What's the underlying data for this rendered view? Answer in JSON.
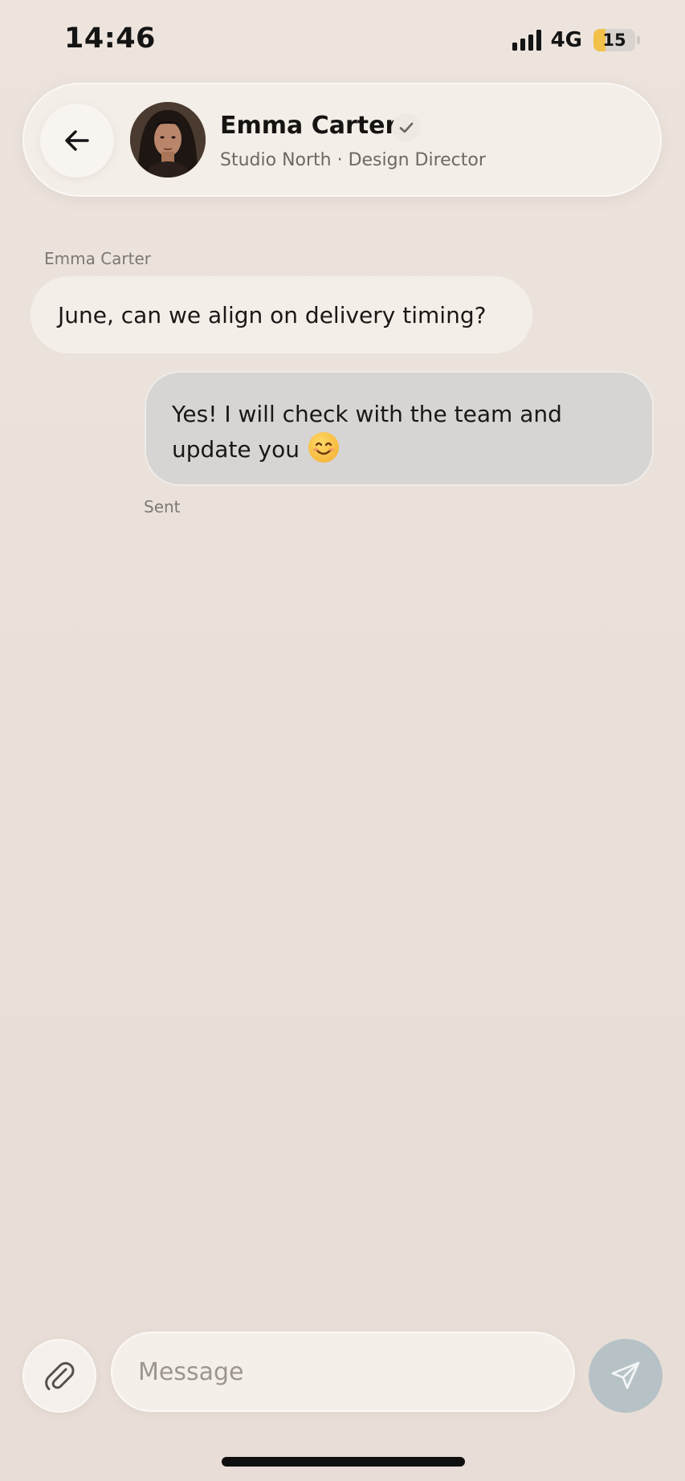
{
  "status_bar": {
    "time": "14:46",
    "network": "4G",
    "battery_level": "15"
  },
  "header": {
    "back_icon": "arrow-left-icon",
    "contact_name": "Emma Carter",
    "verified_icon": "checkmark-icon",
    "subtitle": "Studio North · Design Director"
  },
  "messages": [
    {
      "direction": "incoming",
      "sender": "Emma Carter",
      "text": "June, can we align on delivery timing?"
    },
    {
      "direction": "outgoing",
      "text_line1": "Yes! I will check with the team and",
      "text_line2": "update you",
      "emoji_icon": "smiling-face-emoji",
      "status": "Sent"
    }
  ],
  "composer": {
    "attach_icon": "paperclip-icon",
    "placeholder": "Message",
    "value": "",
    "send_icon": "send-icon"
  },
  "colors": {
    "background": "#ebe3dc",
    "incoming_bubble": "#f4eee9",
    "outgoing_bubble": "#d6d5d3",
    "send_button": "#b7c2c7",
    "battery_fill": "#f2c14a"
  }
}
